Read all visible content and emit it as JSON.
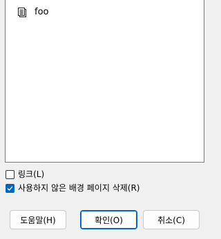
{
  "list": {
    "items": [
      {
        "label": "foo",
        "icon": "document-icon"
      }
    ]
  },
  "options": [
    {
      "label": "링크(L)",
      "checked": false
    },
    {
      "label": "사용하지 않은 배경 페이지 삭제(R)",
      "checked": true
    }
  ],
  "buttons": {
    "help": "도움말(H)",
    "ok": "확인(O)",
    "cancel": "취소(C)"
  },
  "colors": {
    "accent": "#0067c0",
    "background": "#f0f0f0",
    "list_background": "#ffffff"
  }
}
